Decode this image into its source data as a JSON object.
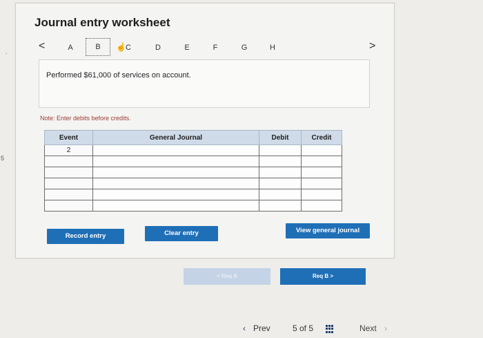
{
  "header": {
    "title": "Journal entry worksheet"
  },
  "tabs": {
    "prev": "<",
    "next": ">",
    "items": [
      "A",
      "B",
      "C",
      "D",
      "E",
      "F",
      "G",
      "H"
    ],
    "selected": "B"
  },
  "question": {
    "text": "Performed $61,000 of services on account."
  },
  "note": "Note: Enter debits before credits.",
  "table": {
    "headers": {
      "event": "Event",
      "journal": "General Journal",
      "debit": "Debit",
      "credit": "Credit"
    },
    "rows": [
      {
        "event": "2",
        "journal": "",
        "debit": "",
        "credit": ""
      },
      {
        "event": "",
        "journal": "",
        "debit": "",
        "credit": ""
      },
      {
        "event": "",
        "journal": "",
        "debit": "",
        "credit": ""
      },
      {
        "event": "",
        "journal": "",
        "debit": "",
        "credit": ""
      },
      {
        "event": "",
        "journal": "",
        "debit": "",
        "credit": ""
      },
      {
        "event": "",
        "journal": "",
        "debit": "",
        "credit": ""
      }
    ]
  },
  "buttons": {
    "record": "Record entry",
    "clear": "Clear entry",
    "view_journal": "View general journal"
  },
  "req_nav": {
    "prev": "< Req A",
    "next": "Req B  >"
  },
  "footer": {
    "prev": "Prev",
    "page": "5 of 5",
    "next": "Next"
  },
  "colors": {
    "button": "#1f6fb7",
    "header": "#cfdbe8",
    "note": "#9a3b32"
  }
}
